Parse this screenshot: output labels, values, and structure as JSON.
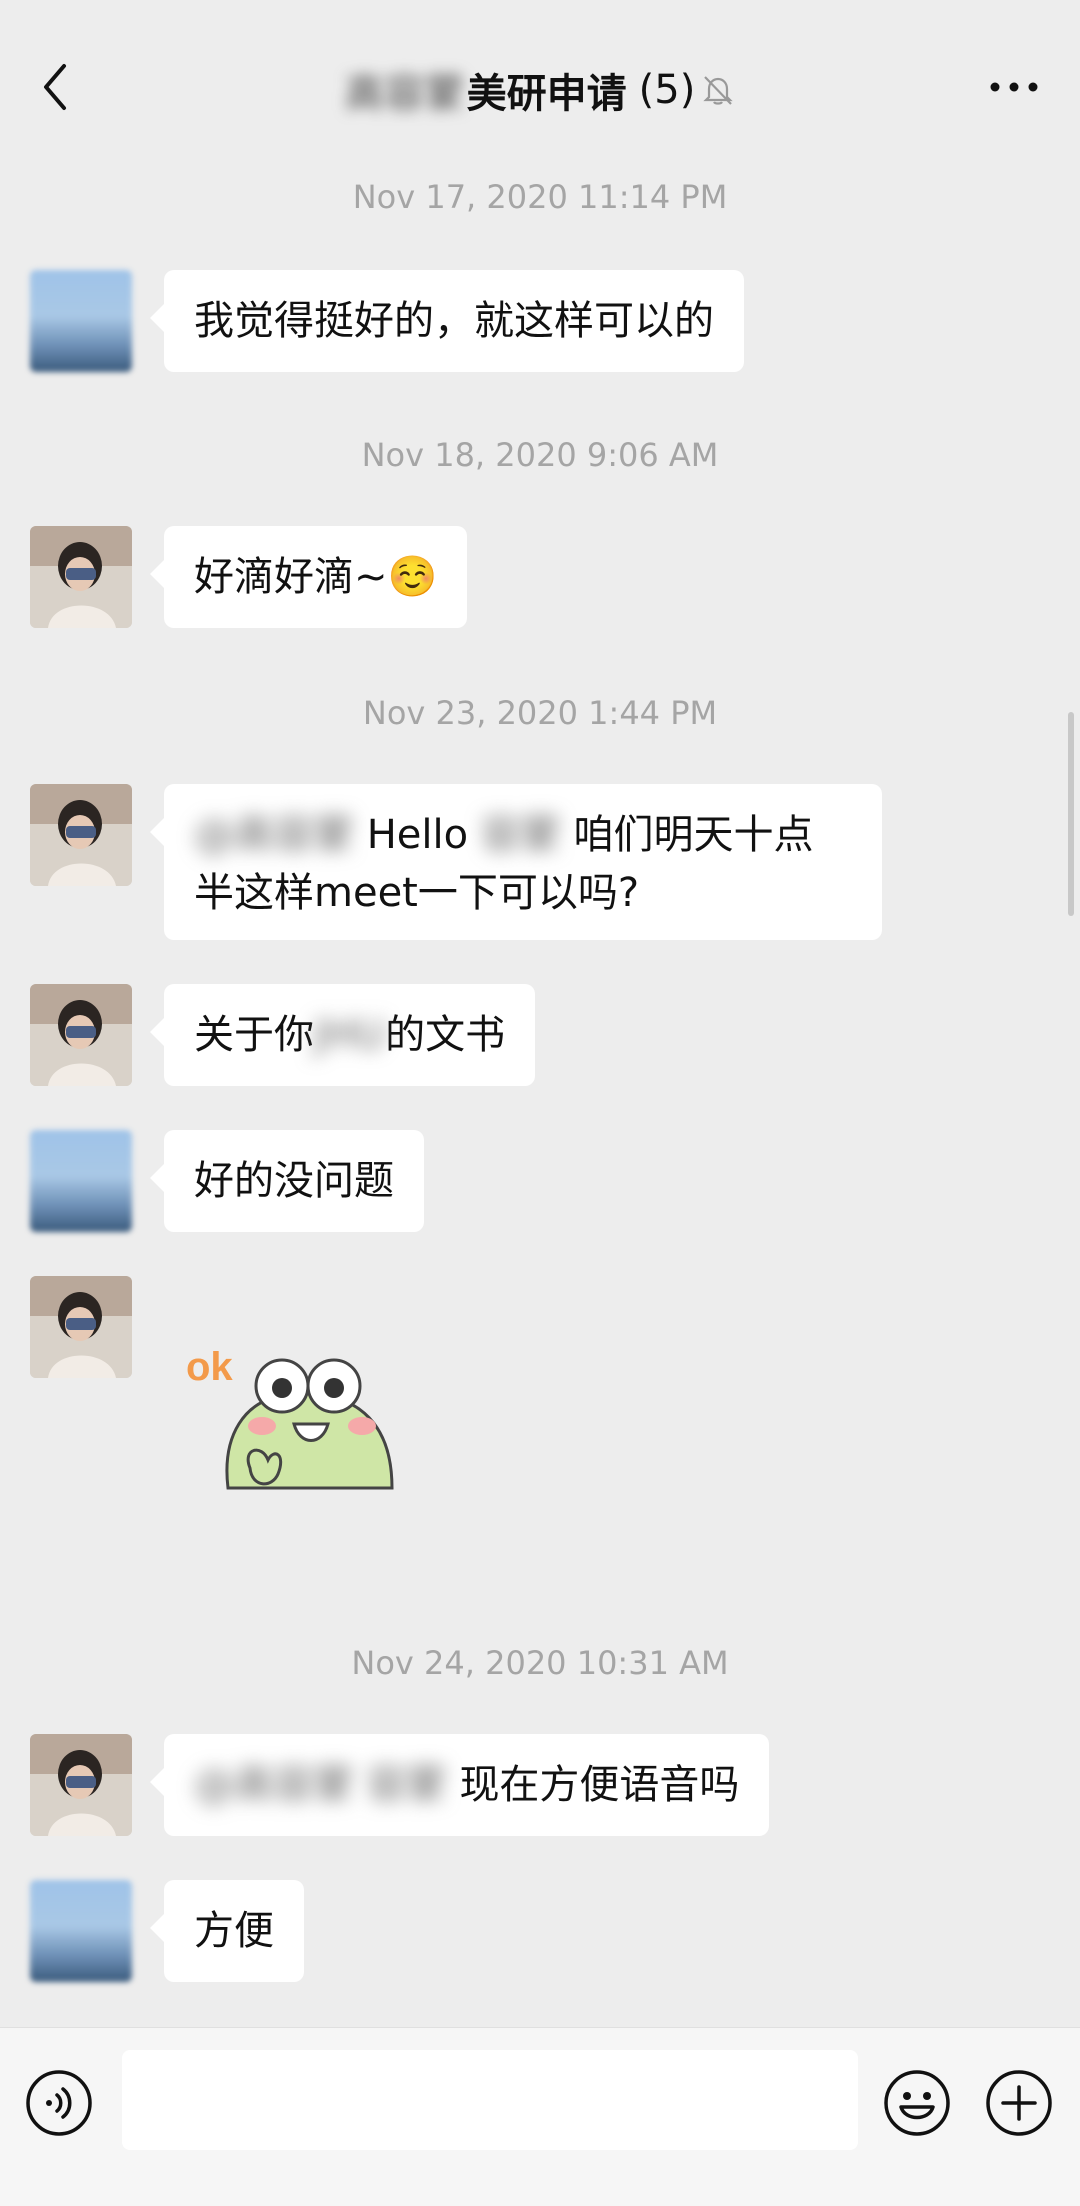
{
  "header": {
    "title_prefix_blurred": "高容蒙",
    "title": "美研申请",
    "member_count": "(5)",
    "back_icon": "chevron-left-icon",
    "mute_icon": "bell-off-icon",
    "more_icon": "more-dots-icon"
  },
  "timestamps": {
    "t1": "Nov 17, 2020 11:14 PM",
    "t2": "Nov 18, 2020 9:06 AM",
    "t3": "Nov 23, 2020 1:44 PM",
    "t4": "Nov 24, 2020 10:31 AM"
  },
  "messages": {
    "m1": {
      "text": "我觉得挺好的，就这样可以的"
    },
    "m2": {
      "text": "好滴好滴~☺️"
    },
    "m3": {
      "blur1": "@高容蒙",
      "text_a": " Hello ",
      "blur2": "容蒙",
      "text_b": " 咱们明天十点",
      "line2": "半这样meet一下可以吗?"
    },
    "m4": {
      "text_a": "关于你",
      "blur": "JHU",
      "text_b": "的文书"
    },
    "m5": {
      "text": "好的没问题"
    },
    "m6": {
      "sticker_label": "ok"
    },
    "m7": {
      "blur": "@高容蒙 容蒙 ",
      "text": "现在方便语音吗"
    },
    "m8": {
      "text": "方便"
    }
  },
  "input_bar": {
    "voice_icon": "voice-icon",
    "emoji_icon": "emoji-icon",
    "plus_icon": "plus-circle-icon",
    "value": ""
  },
  "colors": {
    "background": "#ededed",
    "bubble": "#ffffff",
    "timestamp": "#a5a5a5"
  }
}
